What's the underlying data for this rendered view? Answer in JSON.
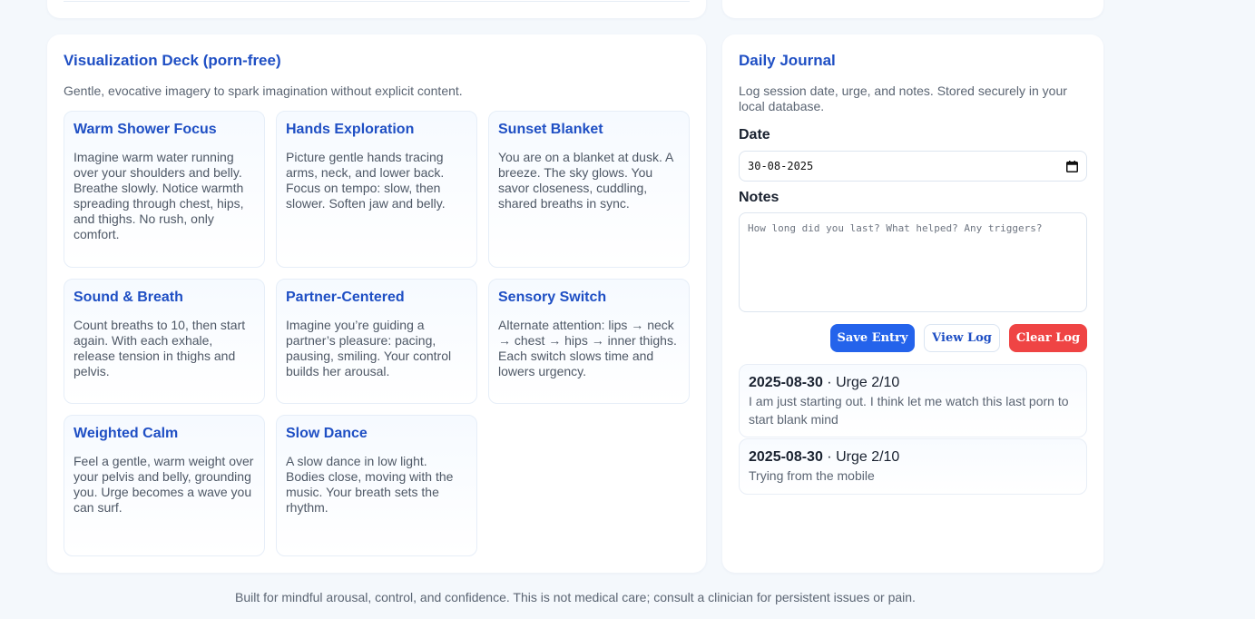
{
  "visualization": {
    "title": "Visualization Deck (porn-free)",
    "description": "Gentle, evocative imagery to spark imagination without explicit content.",
    "cards": [
      {
        "title": "Warm Shower Focus",
        "text": "Imagine warm water running over your shoulders and belly. Breathe slowly. Notice warmth spreading through chest, hips, and thighs. No rush, only comfort."
      },
      {
        "title": "Hands Exploration",
        "text": "Picture gentle hands tracing arms, neck, and lower back. Focus on tempo: slow, then slower. Soften jaw and belly."
      },
      {
        "title": "Sunset Blanket",
        "text": "You are on a blanket at dusk. A breeze. The sky glows. You savor closeness, cuddling, shared breaths in sync."
      },
      {
        "title": "Sound & Breath",
        "text": "Count breaths to 10, then start again. With each exhale, release tension in thighs and pelvis."
      },
      {
        "title": "Partner-Centered",
        "text": "Imagine you’re guiding a partner’s pleasure: pacing, pausing, smiling. Your control builds her arousal."
      },
      {
        "title": "Sensory Switch",
        "text": "Alternate attention: lips → neck → chest → hips → inner thighs. Each switch slows time and lowers urgency."
      },
      {
        "title": "Weighted Calm",
        "text": "Feel a gentle, warm weight over your pelvis and belly, grounding you. Urge becomes a wave you can surf."
      },
      {
        "title": "Slow Dance",
        "text": "A slow dance in low light. Bodies close, moving with the music. Your breath sets the rhythm."
      }
    ]
  },
  "journal": {
    "title": "Daily Journal",
    "description": "Log session date, urge, and notes. Stored securely in your local database.",
    "date_label": "Date",
    "date_value": "30-08-2025",
    "notes_label": "Notes",
    "notes_placeholder": "How long did you last? What helped? Any triggers?",
    "buttons": {
      "save": "Save Entry",
      "view": "View Log",
      "clear": "Clear Log"
    },
    "entries": [
      {
        "date": "2025-08-30",
        "urge": " · Urge 2/10",
        "note": "I am just starting out. I think let me watch this last porn to start blank mind"
      },
      {
        "date": "2025-08-30",
        "urge": " · Urge 2/10",
        "note": "Trying from the mobile"
      }
    ]
  },
  "footer": "Built for mindful arousal, control, and confidence. This is not medical care; consult a clinician for persistent issues or pain.",
  "colors": {
    "accent": "#1f4fc4",
    "primary_button": "#2463eb",
    "danger_button": "#ef4444",
    "background": "#f4f8fc"
  },
  "icons": {
    "date_picker": "calendar-icon"
  }
}
